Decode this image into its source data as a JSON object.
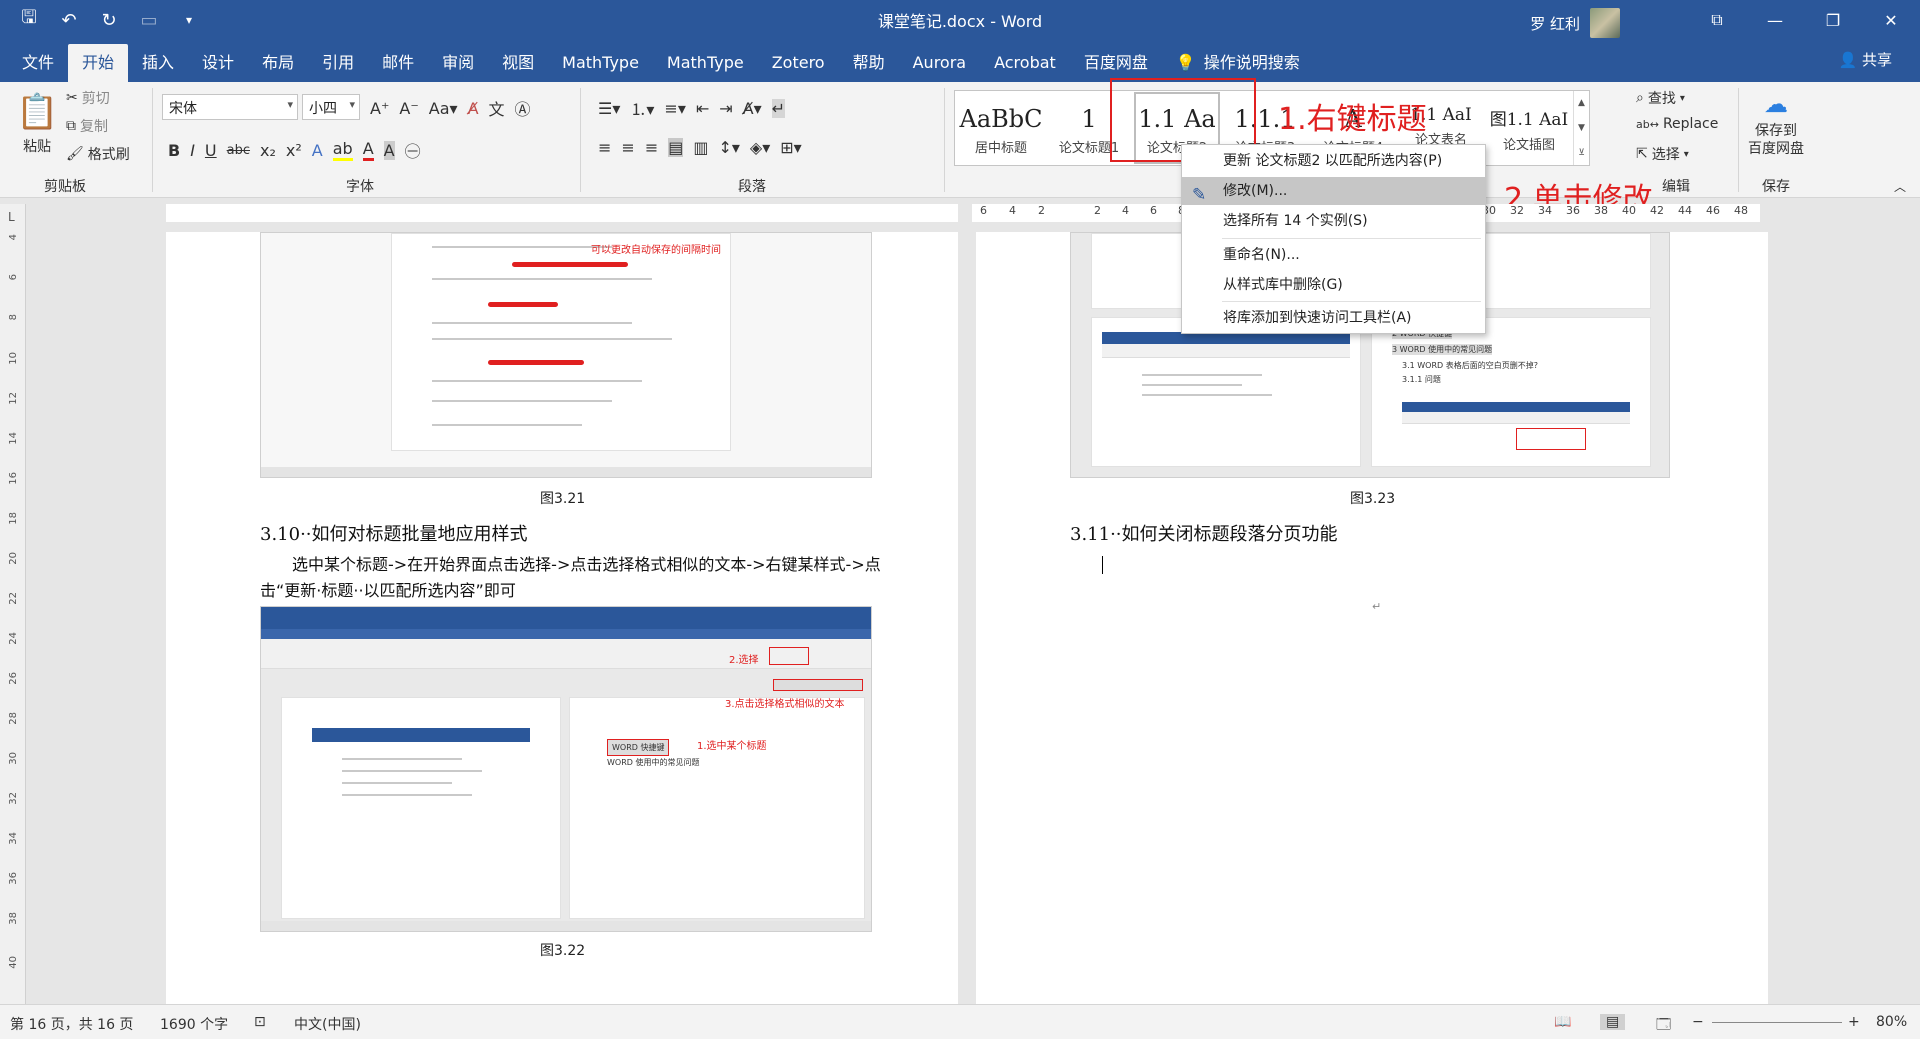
{
  "titlebar": {
    "doc_title": "课堂笔记.docx - Word",
    "user_name": "罗 红利",
    "quick_access": [
      "save-icon",
      "undo-icon",
      "redo-icon",
      "touch-icon",
      "customize-icon"
    ]
  },
  "tabs": [
    {
      "label": "文件"
    },
    {
      "label": "开始"
    },
    {
      "label": "插入"
    },
    {
      "label": "设计"
    },
    {
      "label": "布局"
    },
    {
      "label": "引用"
    },
    {
      "label": "邮件"
    },
    {
      "label": "审阅"
    },
    {
      "label": "视图"
    },
    {
      "label": "MathType"
    },
    {
      "label": "MathType"
    },
    {
      "label": "Zotero"
    },
    {
      "label": "帮助"
    },
    {
      "label": "Aurora"
    },
    {
      "label": "Acrobat"
    },
    {
      "label": "百度网盘"
    }
  ],
  "tell_me": "操作说明搜索",
  "share": "共享",
  "ribbon": {
    "clipboard": {
      "paste": "粘贴",
      "cut": "剪切",
      "copy": "复制",
      "format_painter": "格式刷",
      "label": "剪贴板"
    },
    "font": {
      "name": "宋体",
      "size": "小四",
      "label": "字体"
    },
    "paragraph": {
      "label": "段落"
    },
    "styles": [
      {
        "sample": "AaBbC",
        "name": "居中标题"
      },
      {
        "sample": "1",
        "name": "论文标题1"
      },
      {
        "sample": "1.1 Aa",
        "name": "论文标题2"
      },
      {
        "sample": "1.1.1",
        "name": "论文标题3"
      },
      {
        "sample": "A",
        "name": "论文标题4"
      },
      {
        "sample": "1.1 AaI",
        "name": "论文表名"
      },
      {
        "sample": "图1.1 AaI",
        "name": "论文插图"
      }
    ],
    "editing": {
      "find": "查找",
      "replace": "Replace",
      "select": "选择",
      "label": "编辑"
    },
    "save": {
      "button": "保存到\n百度网盘",
      "label": "保存"
    }
  },
  "annotations": {
    "step1": "1.右键标题",
    "step2": "2.单击修改"
  },
  "context_menu": {
    "items": [
      {
        "label": "更新 论文标题2 以匹配所选内容(P)"
      },
      {
        "label": "修改(M)..."
      },
      {
        "label": "选择所有 14 个实例(S)"
      },
      {
        "label": "重命名(N)..."
      },
      {
        "label": "从样式库中删除(G)"
      },
      {
        "label": "将库添加到快速访问工具栏(A)"
      }
    ]
  },
  "ruler_right": [
    "6",
    "4",
    "2",
    "2",
    "4",
    "6",
    "8",
    "30",
    "32",
    "34",
    "36",
    "38",
    "40",
    "42",
    "44",
    "46",
    "48"
  ],
  "ruler_left": [
    "4",
    "6",
    "8",
    "10",
    "12",
    "14",
    "16",
    "18",
    "20",
    "22",
    "24",
    "26",
    "28",
    "30",
    "32",
    "34",
    "36",
    "38",
    "40"
  ],
  "left_page": {
    "fig1_caption": "图3.21",
    "fig1_note": "可以更改自动保存的间隔时间",
    "heading": "3.10··如何对标题批量地应用样式",
    "paragraph_line1": "选中某个标题->在开始界面点击选择->点击选择格式相似的文本->右键某样式->点",
    "paragraph_line2": "击“更新·标题··以匹配所选内容”即可",
    "fig2_caption": "图3.22",
    "fig2_note_select": "2.选择",
    "fig2_note_similar": "3.点击选择格式相似的文本",
    "fig2_note_title": "1.选中某个标题",
    "fig2_item1": "WORD 快捷键",
    "fig2_item2": "WORD 使用中的常见问题"
  },
  "right_page": {
    "fig_caption": "图3.23",
    "heading": "3.11··如何关闭标题段落分页功能",
    "fig_items": [
      "2 WORD 快捷键",
      "3 WORD 使用中的常见问题",
      "3.1 WORD 表格后面的空白页删不掉?",
      "3.1.1 问题"
    ]
  },
  "status": {
    "page": "第 16 页，共 16 页",
    "words": "1690 个字",
    "language": "中文(中国)",
    "zoom": "80%"
  }
}
